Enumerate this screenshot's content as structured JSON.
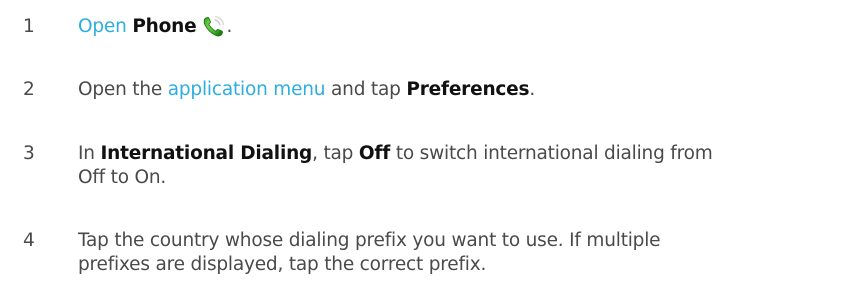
{
  "steps": [
    {
      "number": "1",
      "open_link": "Open",
      "phone_label": "Phone",
      "end": ".",
      "icon": "phone-app-icon"
    },
    {
      "number": "2",
      "text_before": "Open the",
      "menu_link": "application menu",
      "text_middle": "and tap",
      "preferences_label": "Preferences",
      "end": "."
    },
    {
      "number": "3",
      "text_before": "In",
      "intl_label": "International Dialing",
      "text_middle": ", tap",
      "off_label": "Off",
      "line1_end": "to switch international dialing from",
      "line2": "Off to On."
    },
    {
      "number": "4",
      "line1": "Tap the country whose dialing prefix you want to use. If multiple",
      "line2": "prefixes are displayed, tap the correct prefix."
    }
  ],
  "colors": {
    "text": "#4a4a4a",
    "bold": "#111111",
    "link": "#2eaee0",
    "background": "#ffffff"
  }
}
